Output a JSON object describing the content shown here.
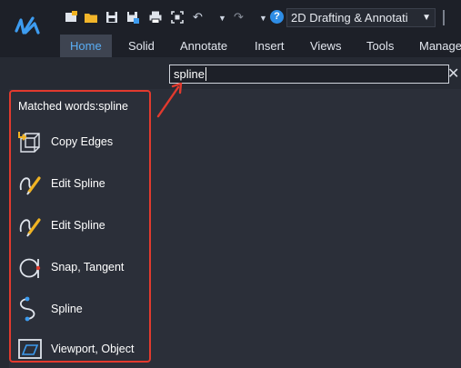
{
  "toolbar": {
    "workspace": "2D Drafting & Annotati"
  },
  "tabs": [
    {
      "label": "Home",
      "active": true
    },
    {
      "label": "Solid"
    },
    {
      "label": "Annotate"
    },
    {
      "label": "Insert"
    },
    {
      "label": "Views"
    },
    {
      "label": "Tools"
    },
    {
      "label": "Manage"
    }
  ],
  "search": {
    "value": "spline"
  },
  "results": {
    "header": "Matched words:spline",
    "items": [
      {
        "label": "Copy Edges",
        "icon": "copy-edges-icon"
      },
      {
        "label": "Edit Spline",
        "icon": "edit-spline-icon"
      },
      {
        "label": "Edit Spline",
        "icon": "edit-spline-icon"
      },
      {
        "label": "Snap, Tangent",
        "icon": "snap-tangent-icon"
      },
      {
        "label": "Spline",
        "icon": "spline-icon"
      },
      {
        "label": "Viewport, Object",
        "icon": "viewport-object-icon"
      }
    ]
  },
  "colors": {
    "accent": "#5aaef5",
    "highlight_border": "#e23a2e",
    "background": "#2b2f39"
  }
}
